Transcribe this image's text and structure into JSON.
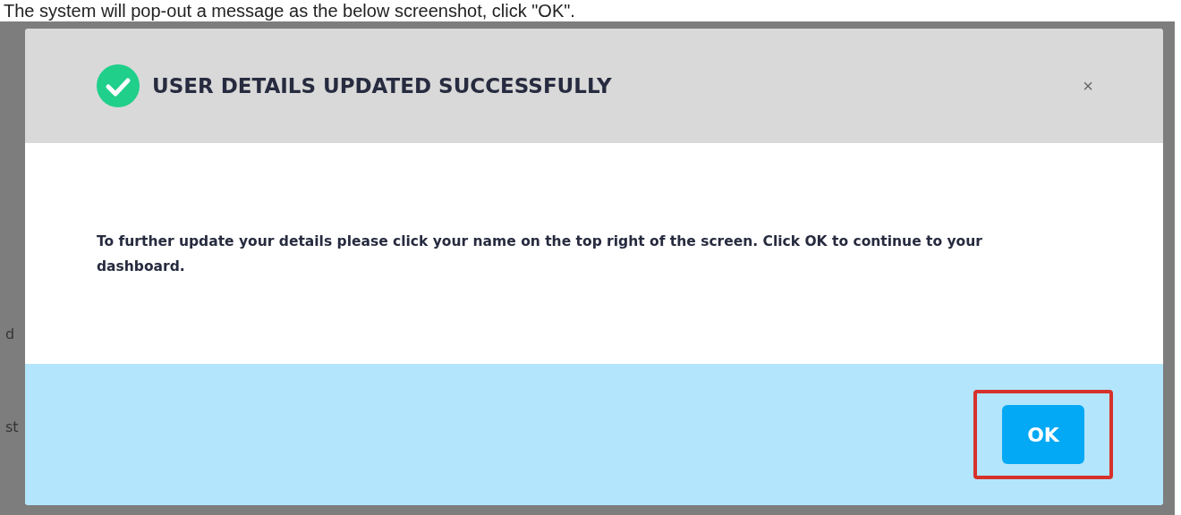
{
  "caption": "The system will pop-out a message as the below screenshot, click \"OK\".",
  "background_fragments": [
    "d",
    "st"
  ],
  "dialog": {
    "title": "USER DETAILS UPDATED SUCCESSFULLY",
    "close": "×",
    "message": "To further update your details please click your name on the top right of the screen. Click OK to continue to your dashboard.",
    "ok_button": {
      "label": "OK",
      "highlighted": true
    }
  }
}
